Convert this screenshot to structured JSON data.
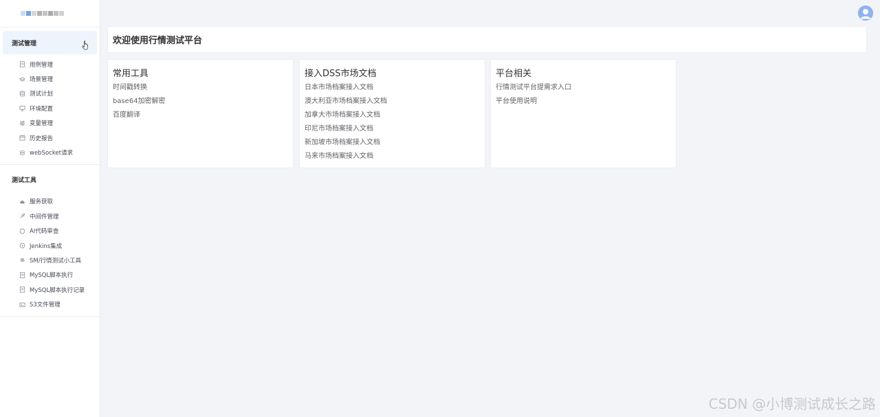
{
  "sidebar": {
    "logo_colors": [
      "#c9dcf5",
      "#6fa3e6",
      "#d7d7d7",
      "#b0b0b0",
      "#c4c4c4",
      "#a9a9a9",
      "#bfbfbf",
      "#d0d0d0"
    ],
    "groups": [
      {
        "title": "测试管理",
        "active": true,
        "items": [
          {
            "label": "用例管理",
            "icon": "document-icon"
          },
          {
            "label": "场景管理",
            "icon": "layers-icon"
          },
          {
            "label": "测试计划",
            "icon": "database-icon"
          },
          {
            "label": "环境配置",
            "icon": "monitor-icon"
          },
          {
            "label": "变量管理",
            "icon": "sliders-icon"
          },
          {
            "label": "历史报告",
            "icon": "calendar-icon"
          },
          {
            "label": "webSocket请求",
            "icon": "link-icon"
          }
        ]
      },
      {
        "title": "测试工具",
        "active": false,
        "items": [
          {
            "label": "服务获取",
            "icon": "cloud-icon"
          },
          {
            "label": "中间件管理",
            "icon": "tools-icon"
          },
          {
            "label": "AI代码审查",
            "icon": "circle-icon"
          },
          {
            "label": "Jenkins集成",
            "icon": "play-circle-icon"
          },
          {
            "label": "SM/行情测试小工具",
            "icon": "gear-icon"
          },
          {
            "label": "MySQL脚本执行",
            "icon": "document-icon"
          },
          {
            "label": "MySQL脚本执行记录",
            "icon": "document-icon"
          },
          {
            "label": "S3文件管理",
            "icon": "folder-icon"
          }
        ]
      }
    ]
  },
  "header": {
    "avatar_icon": "user-avatar-icon"
  },
  "main": {
    "welcome_title": "欢迎使用行情测试平台",
    "cards": [
      {
        "title": "常用工具",
        "links": [
          "时间戳转换",
          "base64加密解密",
          "百度翻译"
        ]
      },
      {
        "title": "接入DSS市场文档",
        "links": [
          "日本市场档案接入文档",
          "澳大利亚市场档案接入文档",
          "加拿大市场档案接入文档",
          "印尼市场档案接入文档",
          "新加坡市场档案接入文档",
          "马来市场档案接入文档"
        ]
      },
      {
        "title": "平台相关",
        "links": [
          "行情测试平台提需求入口",
          "平台使用说明"
        ]
      }
    ]
  },
  "watermark": "CSDN @小博测试成长之路"
}
